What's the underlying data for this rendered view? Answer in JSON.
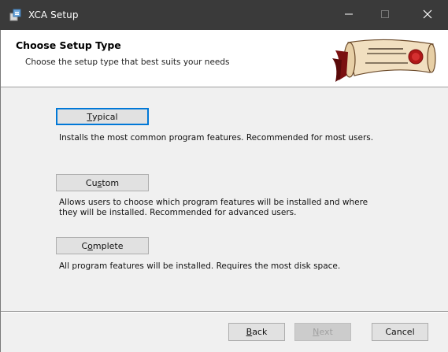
{
  "window": {
    "title": "XCA Setup"
  },
  "header": {
    "title": "Choose Setup Type",
    "subtitle": "Choose the setup type that best suits your needs"
  },
  "options": [
    {
      "label_first": "T",
      "label_rest": "ypical",
      "description": "Installs the most common program features. Recommended for most users."
    },
    {
      "label_pre": "Cu",
      "label_ul": "s",
      "label_post": "tom",
      "description_line1": "Allows users to choose which program features will be installed and where",
      "description_line2": "they will be installed. Recommended for advanced users."
    },
    {
      "label_pre": "C",
      "label_ul": "o",
      "label_post": "mplete",
      "description": "All program features will be installed. Requires the most disk space."
    }
  ],
  "footer": {
    "back_ul": "B",
    "back_rest": "ack",
    "next_ul": "N",
    "next_rest": "ext",
    "cancel": "Cancel"
  },
  "colors": {
    "titlebar": "#3a3a3a",
    "focus_border": "#0078d7",
    "button_face": "#e1e1e1"
  },
  "icons": {
    "app": "installer-icon",
    "minimize": "minimize-icon",
    "maximize": "maximize-icon",
    "close": "close-icon",
    "banner": "certificate-scroll-art"
  }
}
